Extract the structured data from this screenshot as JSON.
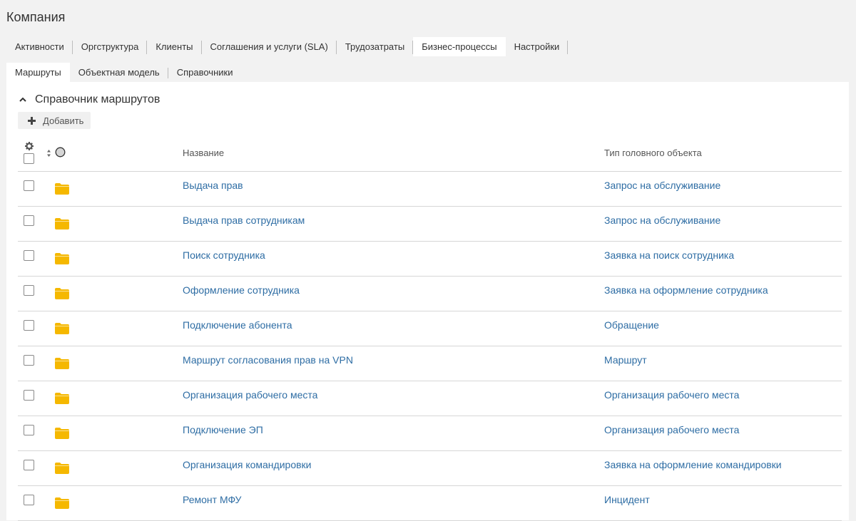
{
  "page": {
    "title": "Компания"
  },
  "main_tabs": [
    {
      "label": "Активности",
      "active": false
    },
    {
      "label": "Оргструктура",
      "active": false
    },
    {
      "label": "Клиенты",
      "active": false
    },
    {
      "label": "Соглашения и услуги (SLA)",
      "active": false
    },
    {
      "label": "Трудозатраты",
      "active": false
    },
    {
      "label": "Бизнес-процессы",
      "active": true
    },
    {
      "label": "Настройки",
      "active": false
    }
  ],
  "sub_tabs": [
    {
      "label": "Маршруты",
      "active": true
    },
    {
      "label": "Объектная модель",
      "active": false
    },
    {
      "label": "Справочники",
      "active": false
    }
  ],
  "section": {
    "title": "Справочник маршрутов",
    "add_label": "Добавить",
    "collapse_icon": "chevron-up-icon"
  },
  "table": {
    "columns": {
      "name": "Название",
      "type": "Тип головного объекта"
    },
    "rows": [
      {
        "name": "Выдача прав",
        "type": "Запрос на обслуживание"
      },
      {
        "name": "Выдача прав сотрудникам",
        "type": "Запрос на обслуживание"
      },
      {
        "name": "Поиск сотрудника",
        "type": "Заявка на поиск сотрудника"
      },
      {
        "name": "Оформление сотрудника",
        "type": "Заявка на оформление сотрудника"
      },
      {
        "name": "Подключение абонента",
        "type": "Обращение"
      },
      {
        "name": "Маршрут согласования прав на VPN",
        "type": "Маршрут"
      },
      {
        "name": "Организация рабочего места",
        "type": "Организация рабочего места"
      },
      {
        "name": "Подключение ЭП",
        "type": "Организация рабочего места"
      },
      {
        "name": "Организация командировки",
        "type": "Заявка на оформление командировки"
      },
      {
        "name": "Ремонт МФУ",
        "type": "Инцидент"
      }
    ]
  },
  "colors": {
    "link": "#2e6da4",
    "folder": "#f5b800",
    "background": "#f2f2f2"
  }
}
